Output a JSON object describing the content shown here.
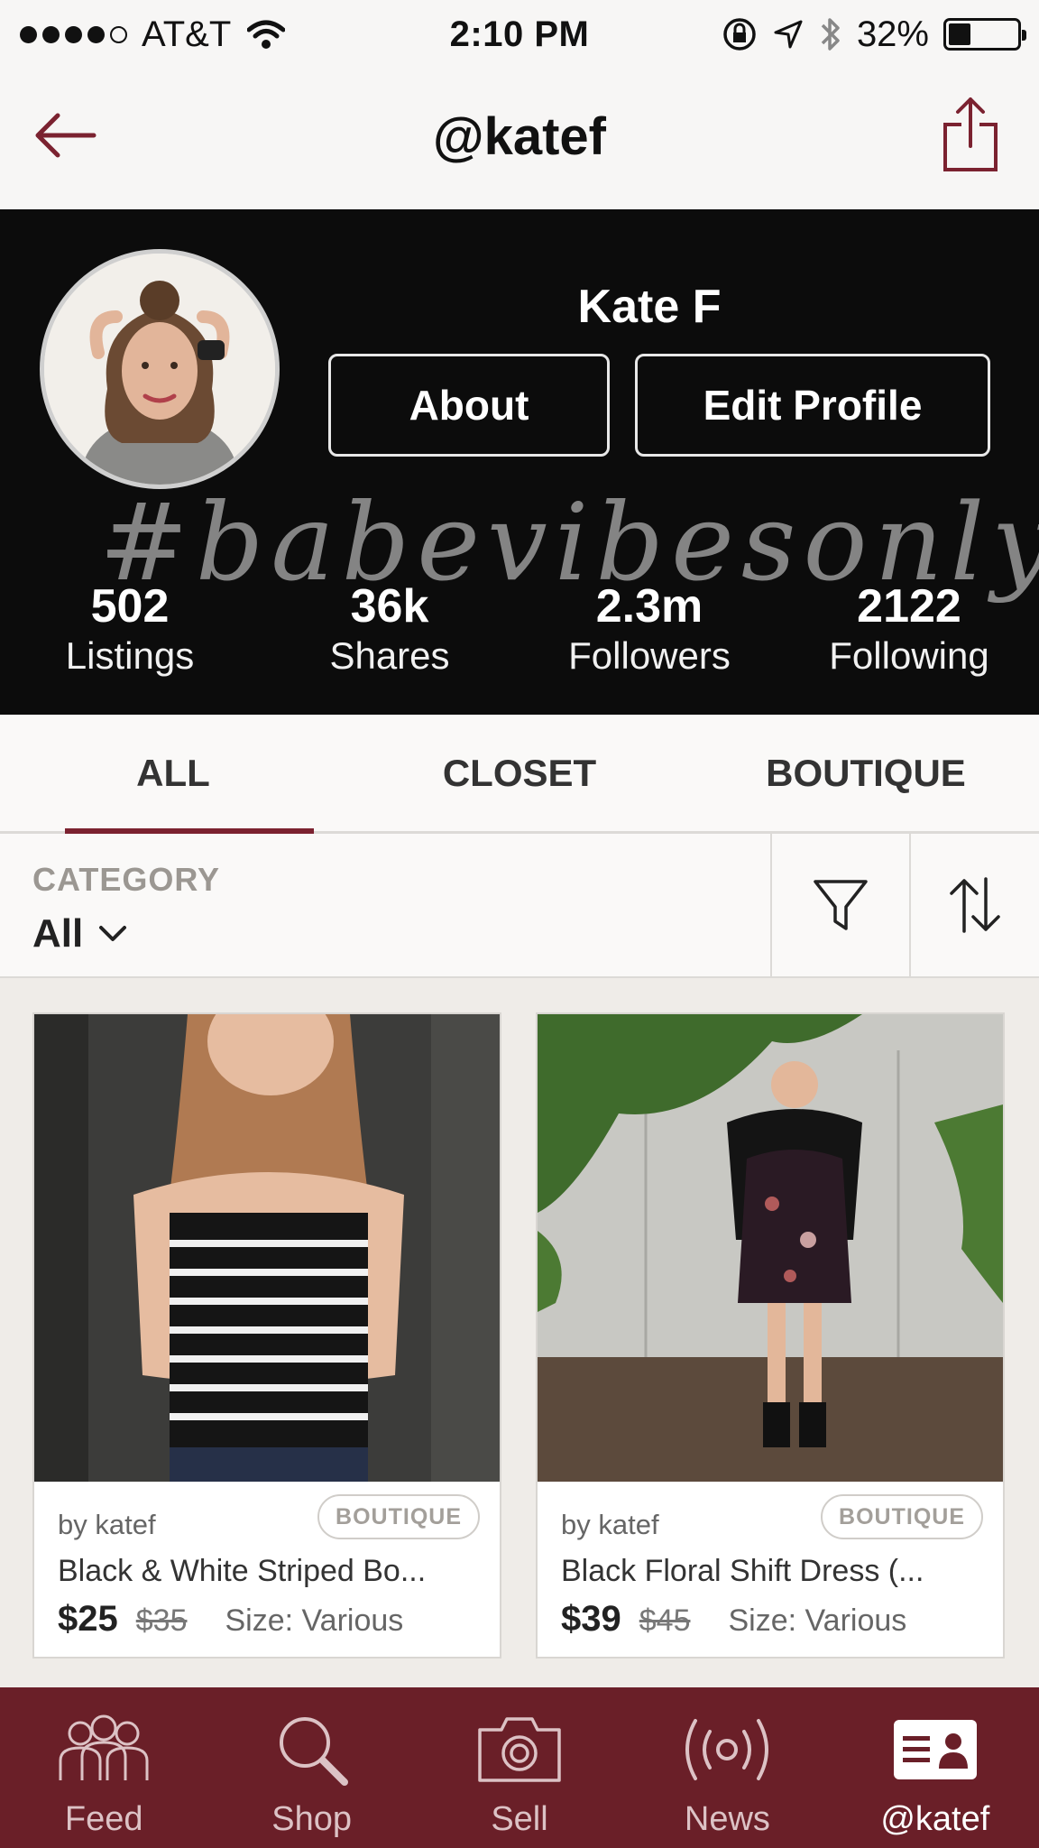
{
  "status_bar": {
    "carrier": "AT&T",
    "time": "2:10 PM",
    "battery": "32%",
    "battery_level": 0.32
  },
  "nav": {
    "title": "@katef",
    "back_icon": "arrow-left-icon",
    "share_icon": "share-icon"
  },
  "profile": {
    "name": "Kate F",
    "about_label": "About",
    "edit_label": "Edit Profile",
    "tagline": "#babevibesonly",
    "stats": [
      {
        "value": "502",
        "label": "Listings"
      },
      {
        "value": "36k",
        "label": "Shares"
      },
      {
        "value": "2.3m",
        "label": "Followers"
      },
      {
        "value": "2122",
        "label": "Following"
      }
    ]
  },
  "tabs": [
    {
      "label": "ALL",
      "active": true
    },
    {
      "label": "CLOSET",
      "active": false
    },
    {
      "label": "BOUTIQUE",
      "active": false
    }
  ],
  "filter": {
    "category_label": "CATEGORY",
    "category_value": "All"
  },
  "listings": [
    {
      "by": "by katef",
      "badge": "BOUTIQUE",
      "title": "Black & White Striped Bo...",
      "price": "$25",
      "original_price": "$35",
      "size": "Size: Various"
    },
    {
      "by": "by katef",
      "badge": "BOUTIQUE",
      "title": "Black Floral Shift Dress (...",
      "price": "$39",
      "original_price": "$45",
      "size": "Size: Various"
    }
  ],
  "tabbar": [
    {
      "label": "Feed",
      "icon": "people-icon"
    },
    {
      "label": "Shop",
      "icon": "search-icon"
    },
    {
      "label": "Sell",
      "icon": "camera-icon"
    },
    {
      "label": "News",
      "icon": "broadcast-icon"
    },
    {
      "label": "@katef",
      "icon": "profile-card-icon",
      "active": true
    }
  ],
  "colors": {
    "brand": "#6a1f28",
    "tab_underline": "#7b2230",
    "header_bg": "#0c0c0c"
  }
}
